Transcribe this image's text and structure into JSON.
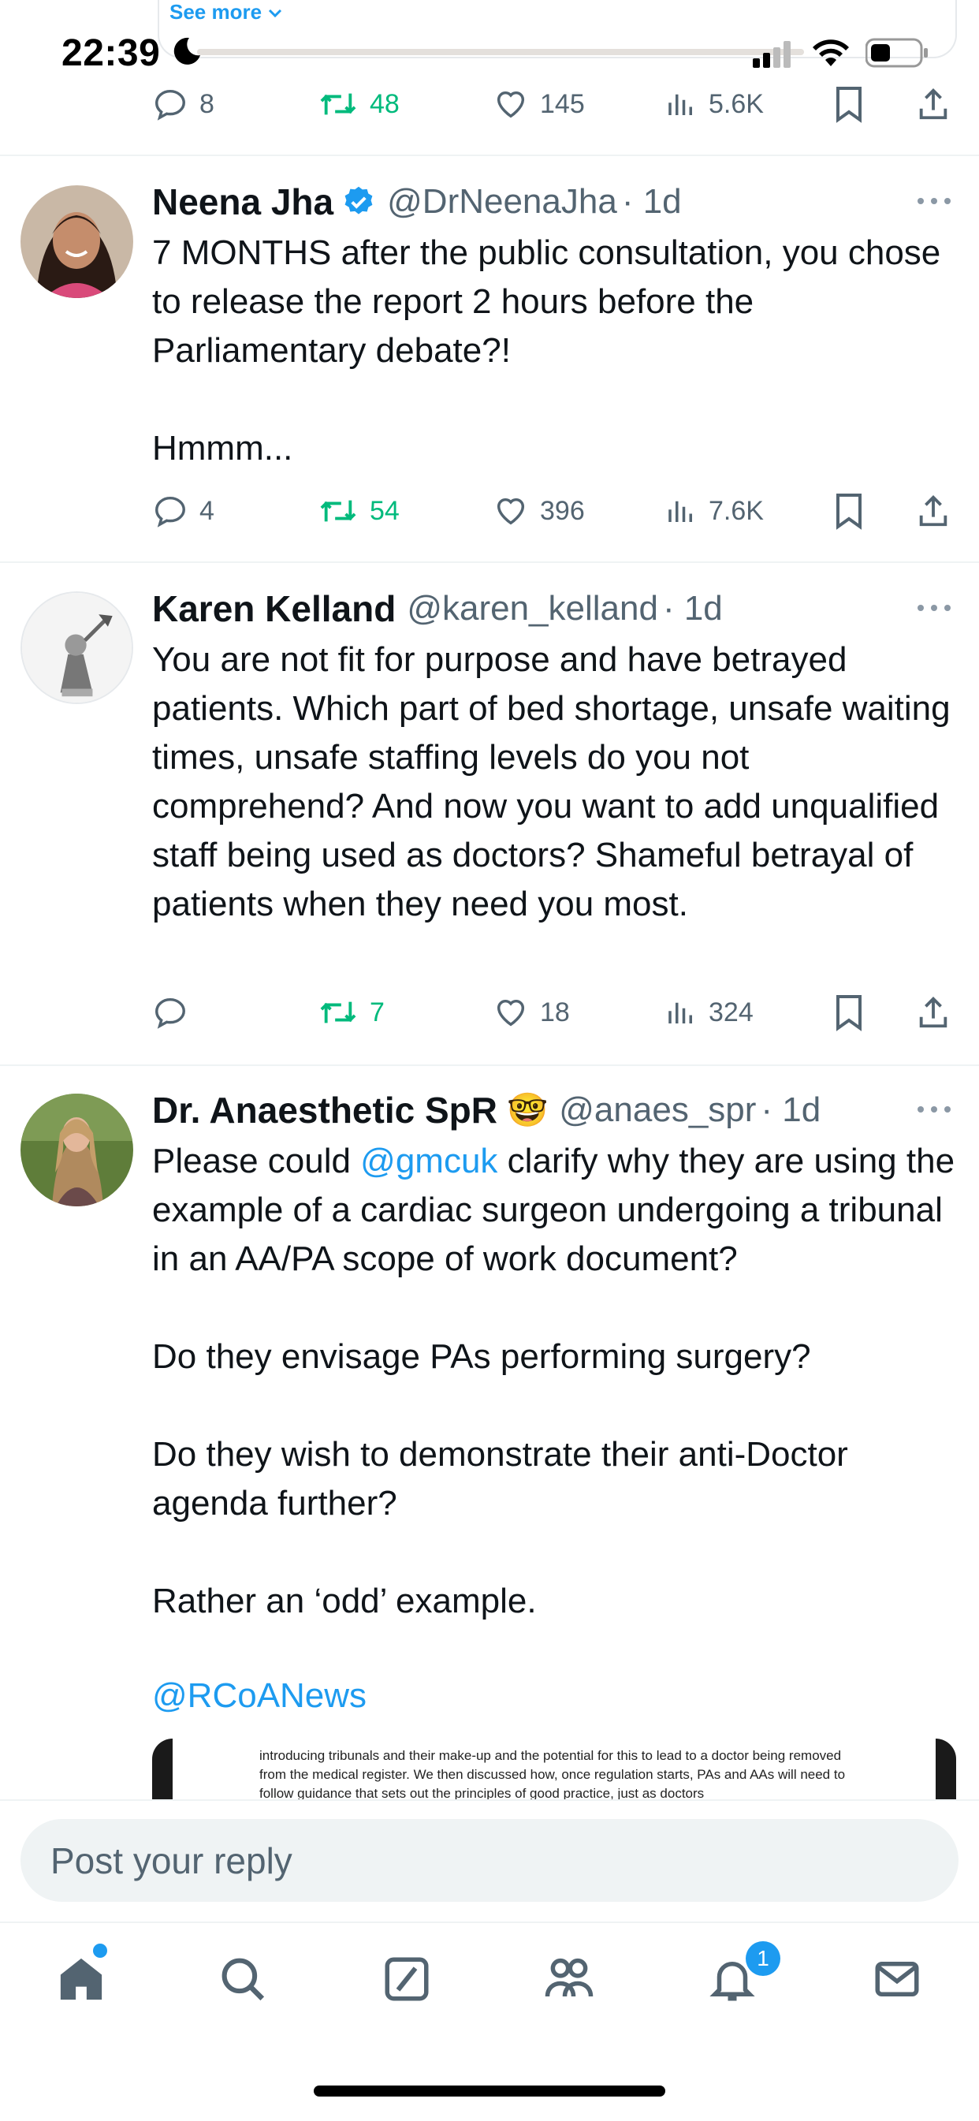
{
  "status_bar": {
    "time": "22:39"
  },
  "previous_tweet": {
    "see_more": "See more"
  },
  "tweets": [
    {
      "counts": {
        "replies": "8",
        "retweets": "48",
        "likes": "145",
        "views": "5.6K"
      }
    },
    {
      "name": "Neena Jha",
      "verified": true,
      "handle": "@DrNeenaJha",
      "time": "· 1d",
      "text": "7 MONTHS after the public consultation, you chose to release the report 2 hours before the Parliamentary debate?!\n\nHmmm...",
      "counts": {
        "replies": "4",
        "retweets": "54",
        "likes": "396",
        "views": "7.6K"
      }
    },
    {
      "name": "Karen Kelland",
      "handle": "@karen_kelland",
      "time": "· 1d",
      "text": "You are not fit for purpose and have betrayed patients. Which part of bed shortage, unsafe waiting times, unsafe staffing levels do you not comprehend? And now you want to add unqualified staff being used as doctors? Shameful betrayal of patients when they need you most.",
      "counts": {
        "replies": "",
        "retweets": "7",
        "likes": "18",
        "views": "324"
      }
    },
    {
      "name": "Dr. Anaesthetic SpR",
      "emoji": "🤓",
      "handle": "@anaes_spr",
      "time": "· 1d",
      "text_before_mention": "Please could ",
      "mention": "@gmcuk",
      "text_after_mention": " clarify why they are using the example of a cardiac surgeon undergoing a tribunal in an AA/PA scope of work document?\n\nDo they envisage PAs performing surgery?\n\nDo they wish to demonstrate their anti-Doctor agenda further?\n\nRather an ‘odd’ example.",
      "mention2": "@RCoANews",
      "image_text": "introducing tribunals and their make-up and the potential for this to lead to a doctor being removed from the medical register. We then discussed how, once regulation starts, PAs and AAs will need to follow guidance that sets out the principles of good practice, just as doctors"
    }
  ],
  "reply_box": {
    "placeholder": "Post your reply"
  },
  "tab_bar": {
    "items": [
      "home-icon",
      "search-icon",
      "compose-icon",
      "communities-icon",
      "notifications-icon",
      "messages-icon"
    ],
    "notification_badge": "1"
  },
  "colors": {
    "accent": "#1d9bf0",
    "retweet": "#00ba7c",
    "muted": "#536471",
    "text": "#0f1419"
  }
}
